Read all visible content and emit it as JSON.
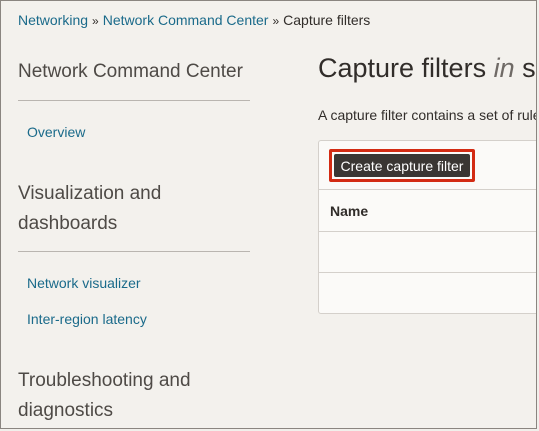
{
  "breadcrumb": {
    "items": [
      "Networking",
      "Network Command Center"
    ],
    "separator": "»",
    "current": "Capture filters"
  },
  "sidebar": {
    "sections": [
      {
        "title": "Network Command Center",
        "links": [
          "Overview"
        ]
      },
      {
        "title": "Visualization and dashboards",
        "links": [
          "Network visualizer",
          "Inter-region latency"
        ]
      },
      {
        "title": "Troubleshooting and diagnostics",
        "links": []
      }
    ]
  },
  "main": {
    "title_prefix": "Capture filters",
    "title_italic": "in",
    "title_suffix": "s",
    "description": "A capture filter contains a set of rule",
    "create_button": "Create capture filter",
    "table": {
      "columns": [
        "Name"
      ],
      "rows": []
    }
  },
  "colors": {
    "link": "#1a6a8a",
    "highlight": "#d32b13",
    "button_bg": "#3a3633"
  }
}
